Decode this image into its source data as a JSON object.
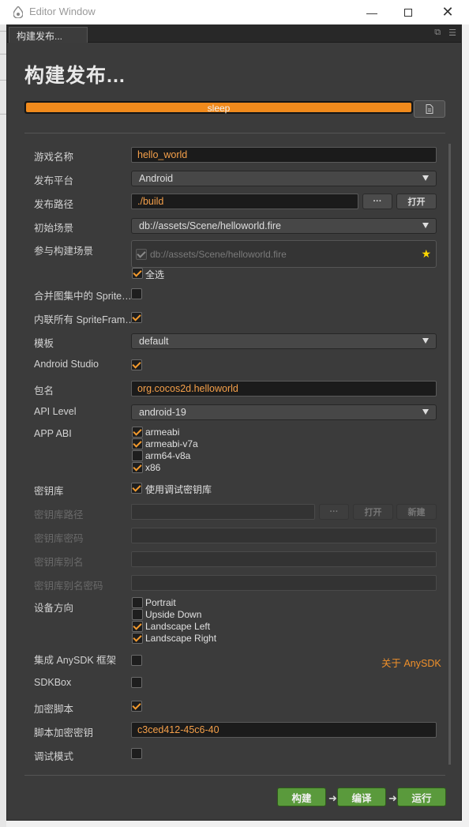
{
  "window": {
    "title": "Editor Window"
  },
  "tab": {
    "label": "构建发布..."
  },
  "page": {
    "heading": "构建发布..."
  },
  "progress": {
    "value": 1.0,
    "status_text": "sleep",
    "color": "#f08a1c"
  },
  "form": {
    "game_name": {
      "label": "游戏名称",
      "value": "hello_world"
    },
    "platform": {
      "label": "发布平台",
      "value": "Android"
    },
    "build_path": {
      "label": "发布路径",
      "value": "./build",
      "ellipsis": "···",
      "open": "打开"
    },
    "start_scene": {
      "label": "初始场景",
      "value": "db://assets/Scene/helloworld.fire"
    },
    "build_scenes": {
      "label": "参与构建场景",
      "scene": "db://assets/Scene/helloworld.fire",
      "select_all": "全选"
    },
    "merge_sprite": {
      "label": "合并图集中的 Sprite…",
      "checked": false
    },
    "inline_sprite": {
      "label": "内联所有 SpriteFram…",
      "checked": true
    },
    "template": {
      "label": "模板",
      "value": "default"
    },
    "android_studio": {
      "label": "Android Studio",
      "checked": true
    },
    "package": {
      "label": "包名",
      "value": "org.cocos2d.helloworld"
    },
    "api_level": {
      "label": "API Level",
      "value": "android-19"
    },
    "app_abi": {
      "label": "APP ABI",
      "options": [
        {
          "label": "armeabi",
          "checked": true
        },
        {
          "label": "armeabi-v7a",
          "checked": true
        },
        {
          "label": "arm64-v8a",
          "checked": false
        },
        {
          "label": "x86",
          "checked": true
        }
      ]
    },
    "keystore": {
      "label": "密钥库",
      "checkbox_label": "使用调试密钥库",
      "checked": true
    },
    "keystore_path": {
      "label": "密钥库路径",
      "ellipsis": "···",
      "open": "打开",
      "new": "新建"
    },
    "keystore_password": {
      "label": "密钥库密码"
    },
    "keystore_alias": {
      "label": "密钥库别名"
    },
    "alias_password": {
      "label": "密钥库别名密码"
    },
    "orientation": {
      "label": "设备方向",
      "options": [
        {
          "label": "Portrait",
          "checked": false
        },
        {
          "label": "Upside Down",
          "checked": false
        },
        {
          "label": "Landscape Left",
          "checked": true
        },
        {
          "label": "Landscape Right",
          "checked": true
        }
      ]
    },
    "anysdk": {
      "label": "集成 AnySDK 框架",
      "checked": false,
      "link": "关于 AnySDK"
    },
    "sdkbox": {
      "label": "SDKBox",
      "checked": false
    },
    "encrypt": {
      "label": "加密脚本",
      "checked": true
    },
    "encrypt_key": {
      "label": "脚本加密密钥",
      "value": "c3ced412-45c6-40"
    },
    "debug": {
      "label": "调试模式",
      "checked": false
    }
  },
  "footer": {
    "build": "构建",
    "compile": "编译",
    "run": "运行"
  }
}
